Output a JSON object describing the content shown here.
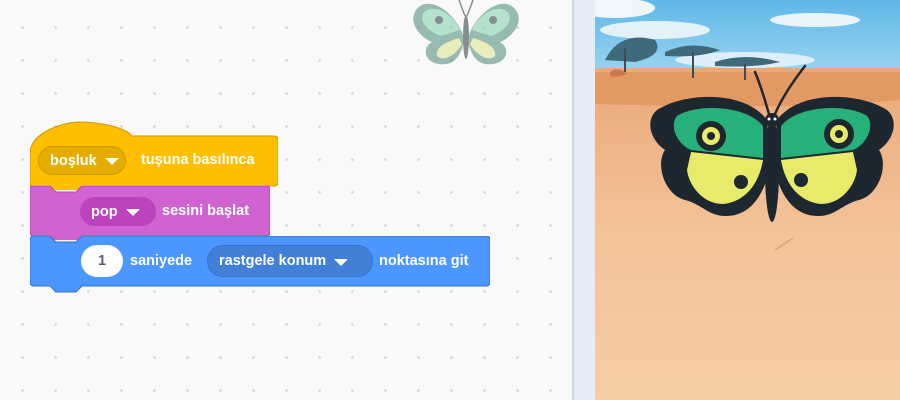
{
  "script": {
    "hat": {
      "key_value": "boşluk",
      "label": "tuşuna basılınca",
      "color": "#ffbf00",
      "dropdown_color": "#e6ac00"
    },
    "sound": {
      "sound_value": "pop",
      "label": "sesini başlat",
      "color": "#cf63cf",
      "dropdown_color": "#bd42bd"
    },
    "motion": {
      "seconds_value": "1",
      "label_seconds": "saniyede",
      "target_value": "rastgele konum",
      "label_end": "noktasına git",
      "color": "#4c97ff",
      "dropdown_color": "#4280d7"
    }
  },
  "sprite": {
    "name_icon": "butterfly-icon"
  },
  "stage": {
    "backdrop": "savanna-icon"
  }
}
